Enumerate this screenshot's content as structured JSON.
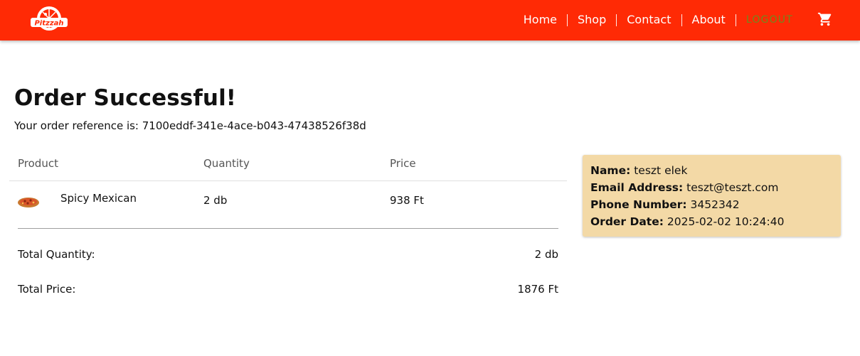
{
  "nav": {
    "logo_text": "Pitzzah",
    "items": [
      "Home",
      "Shop",
      "Contact",
      "About"
    ],
    "logout": "LOGOUT",
    "cart_icon": "shopping-cart-icon"
  },
  "page": {
    "title": "Order Successful!",
    "reference_label": "Your order reference is:",
    "reference_value": "7100eddf-341e-4ace-b043-47438526f38d"
  },
  "table": {
    "headers": [
      "Product",
      "Quantity",
      "Price"
    ],
    "rows": [
      {
        "product": "Spicy Mexican",
        "quantity": "2 db",
        "price": "938 Ft",
        "image": "pizza-thumbnail"
      }
    ]
  },
  "totals": {
    "quantity_label": "Total Quantity:",
    "quantity_value": "2 db",
    "price_label": "Total Price:",
    "price_value": "1876 Ft"
  },
  "customer": {
    "name_label": "Name:",
    "name_value": "teszt elek",
    "email_label": "Email Address:",
    "email_value": "teszt@teszt.com",
    "phone_label": "Phone Number:",
    "phone_value": "3452342",
    "date_label": "Order Date:",
    "date_value": "2025-02-02 10:24:40"
  },
  "colors": {
    "navbar": "#ff2a05",
    "logout": "#6f8a1e",
    "info_box": "#f3d9a6"
  }
}
